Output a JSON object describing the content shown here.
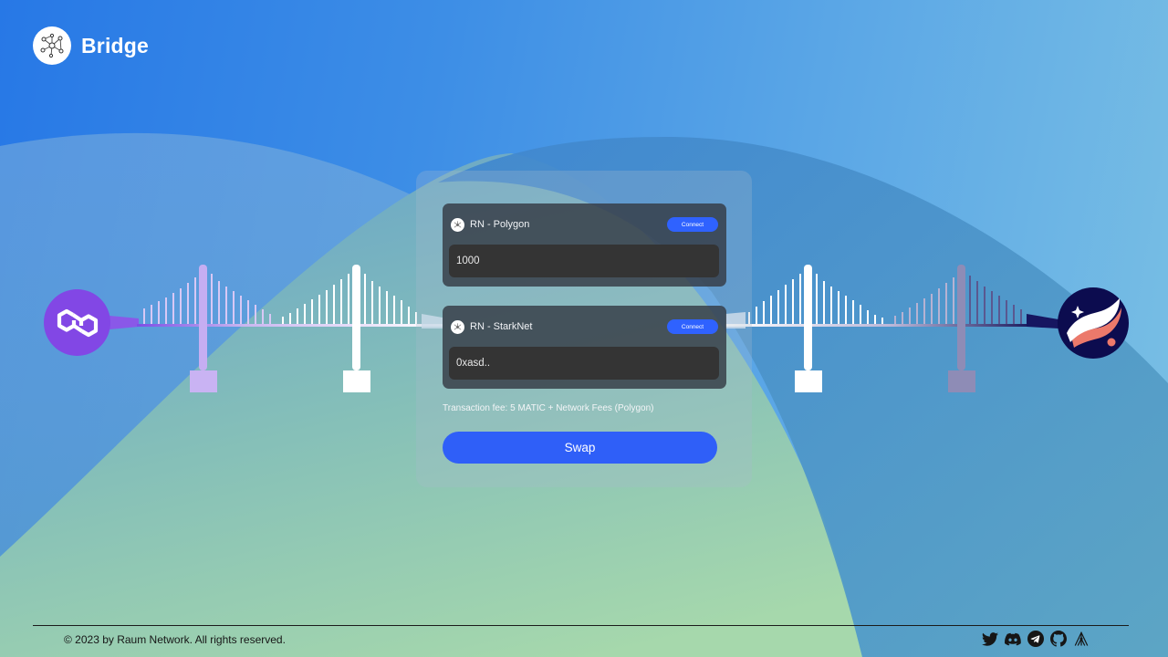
{
  "header": {
    "brand": "Bridge",
    "logo_icon": "network-nodes-icon"
  },
  "chains": {
    "left": {
      "name": "Polygon",
      "icon": "polygon-icon",
      "color": "#8247e5"
    },
    "right": {
      "name": "StarkNet",
      "icon": "starknet-icon",
      "color": "#0c0c4f"
    }
  },
  "swap": {
    "source": {
      "title": "RN - Polygon",
      "connect_label": "Connect",
      "value": "1000"
    },
    "destination": {
      "title": "RN - StarkNet",
      "connect_label": "Connect",
      "value": "0xasd.."
    },
    "fee_text": "Transaction fee: 5 MATIC + Network Fees (Polygon)",
    "swap_label": "Swap",
    "accent": "#2f5ff8"
  },
  "footer": {
    "copyright": "© 2023 by Raum Network. All rights reserved.",
    "socials": [
      "twitter-icon",
      "discord-icon",
      "telegram-icon",
      "github-icon",
      "raum-icon"
    ]
  }
}
